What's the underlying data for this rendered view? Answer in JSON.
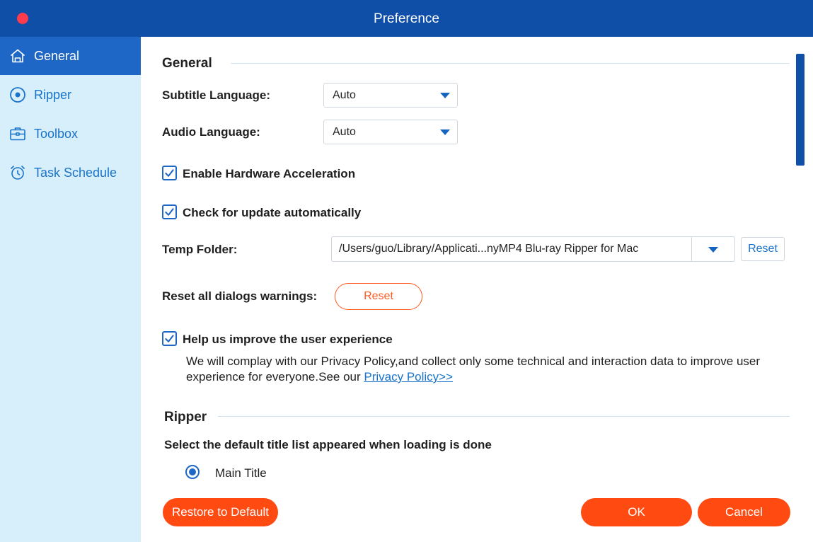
{
  "window": {
    "title": "Preference"
  },
  "sidebar": {
    "items": [
      {
        "label": "General",
        "icon": "home-icon",
        "active": true
      },
      {
        "label": "Ripper",
        "icon": "disc-icon",
        "active": false
      },
      {
        "label": "Toolbox",
        "icon": "toolbox-icon",
        "active": false
      },
      {
        "label": "Task Schedule",
        "icon": "alarm-clock-icon",
        "active": false
      }
    ]
  },
  "general": {
    "section_title": "General",
    "subtitle_language_label": "Subtitle Language:",
    "subtitle_language_value": "Auto",
    "audio_language_label": "Audio Language:",
    "audio_language_value": "Auto",
    "hardware_acceleration_label": "Enable Hardware Acceleration",
    "hardware_acceleration_checked": true,
    "check_update_label": "Check for update automatically",
    "check_update_checked": true,
    "temp_folder_label": "Temp Folder:",
    "temp_folder_value": "/Users/guo/Library/Applicati...nyMP4 Blu-ray Ripper for Mac",
    "temp_folder_reset_label": "Reset",
    "reset_dialogs_label": "Reset all dialogs warnings:",
    "reset_dialogs_button": "Reset",
    "improve_experience_label": "Help us improve the user experience",
    "improve_experience_checked": true,
    "privacy_text": "We will complay with our Privacy Policy,and collect only some technical and interaction data to improve user experience for everyone.See our ",
    "privacy_link": "Privacy Policy>>"
  },
  "ripper": {
    "section_title": "Ripper",
    "title_list_label": "Select the default title list appeared when loading is done",
    "option_main_title": "Main Title",
    "option_main_title_selected": true
  },
  "footer": {
    "restore_label": "Restore to Default",
    "ok_label": "OK",
    "cancel_label": "Cancel"
  },
  "colors": {
    "titlebar": "#0f4fa8",
    "sidebar_bg": "#d7effb",
    "sidebar_active": "#1e67c7",
    "accent_orange": "#ff4a12",
    "close_red": "#ff3b4e"
  }
}
